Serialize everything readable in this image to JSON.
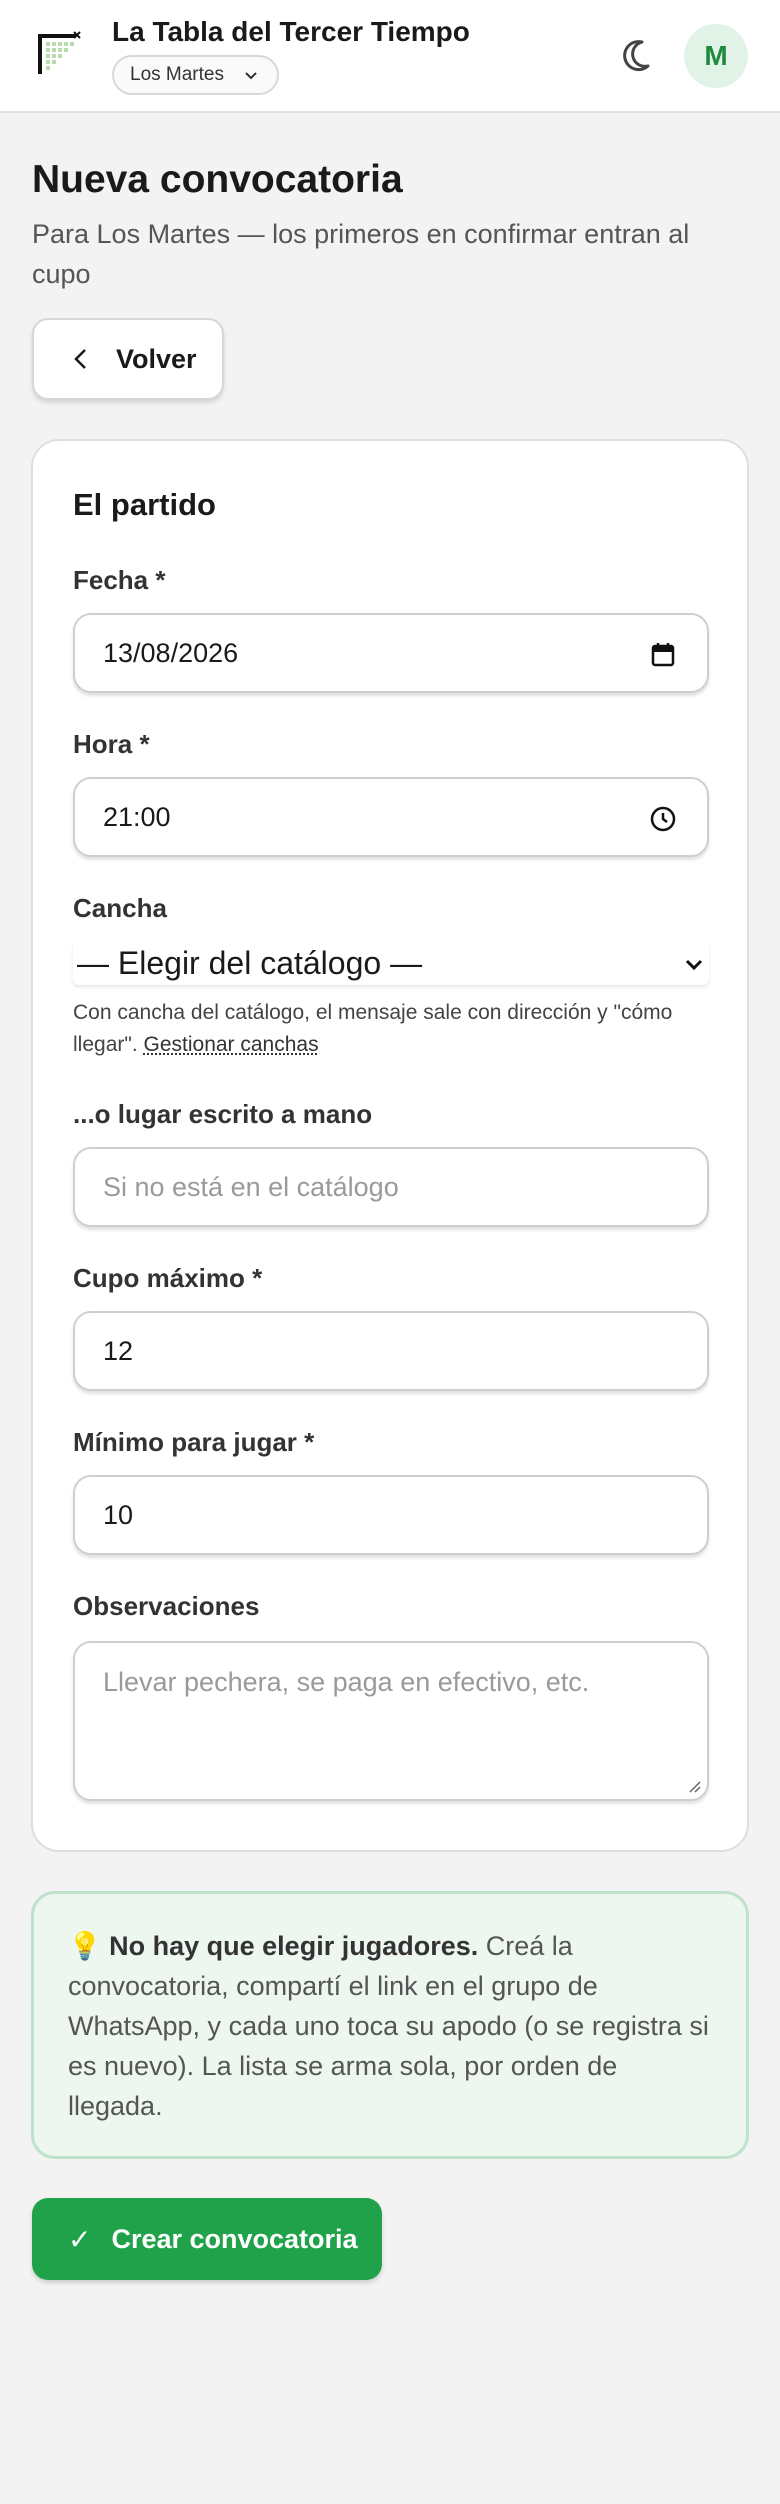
{
  "header": {
    "app_title": "La Tabla del Tercer Tiempo",
    "group_selector": "Los Martes",
    "avatar_initial": "M"
  },
  "page": {
    "title": "Nueva convocatoria",
    "subtitle": "Para Los Martes — los primeros en confirmar entran al cupo",
    "back_label": "Volver"
  },
  "form": {
    "section_title": "El partido",
    "fecha": {
      "label": "Fecha *",
      "value": "13/08/2026"
    },
    "hora": {
      "label": "Hora *",
      "value": "21:00"
    },
    "cancha": {
      "label": "Cancha",
      "selected": "— Elegir del catálogo —",
      "help": "Con cancha del catálogo, el mensaje sale con dirección y \"cómo llegar\".",
      "help_link": "Gestionar canchas"
    },
    "lugar": {
      "label": "...o lugar escrito a mano",
      "placeholder": "Si no está en el catálogo"
    },
    "cupo": {
      "label": "Cupo máximo *",
      "value": "12"
    },
    "minimo": {
      "label": "Mínimo para jugar *",
      "value": "10"
    },
    "observaciones": {
      "label": "Observaciones",
      "placeholder": "Llevar pechera, se paga en efectivo, etc."
    }
  },
  "tip": {
    "emoji": "💡",
    "strong": "No hay que elegir jugadores.",
    "text": " Creá la convocatoria, compartí el link en el grupo de WhatsApp, y cada uno toca su apodo (o se registra si es nuevo). La lista se arma sola, por orden de llegada."
  },
  "submit": {
    "check": "✓",
    "label": "Crear convocatoria"
  },
  "colors": {
    "accent": "#1fa24a",
    "avatar_bg": "#e1f3e6",
    "tip_bg": "#eef6f0"
  }
}
